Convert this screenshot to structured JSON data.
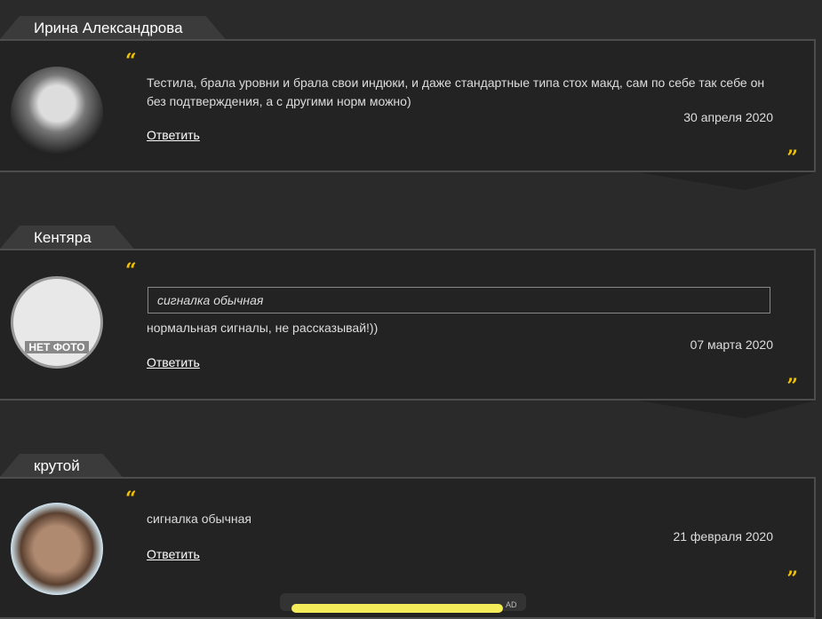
{
  "comments": [
    {
      "author": "Ирина Александрова",
      "text": "Тестила, брала уровни и брала свои индюки, и даже стандартные типа стох макд, сам по себе так себе он без подтверждения, а с другими норм можно)",
      "date": "30 апреля 2020",
      "reply": "Ответить"
    },
    {
      "author": "Кентяра",
      "quote": "сигналка обычная",
      "text": "нормальная сигналы, не рассказывай!))",
      "date": "07 марта 2020",
      "reply": "Ответить",
      "avatar_text": "НЕТ ФОТО"
    },
    {
      "author": "крутой",
      "text": "сигналка обычная",
      "date": "21 февраля 2020",
      "reply": "Ответить"
    }
  ],
  "ad": {
    "label": "AD"
  },
  "colors": {
    "accent": "#f2c200",
    "card": "#232323",
    "background": "#2a2a2a"
  }
}
